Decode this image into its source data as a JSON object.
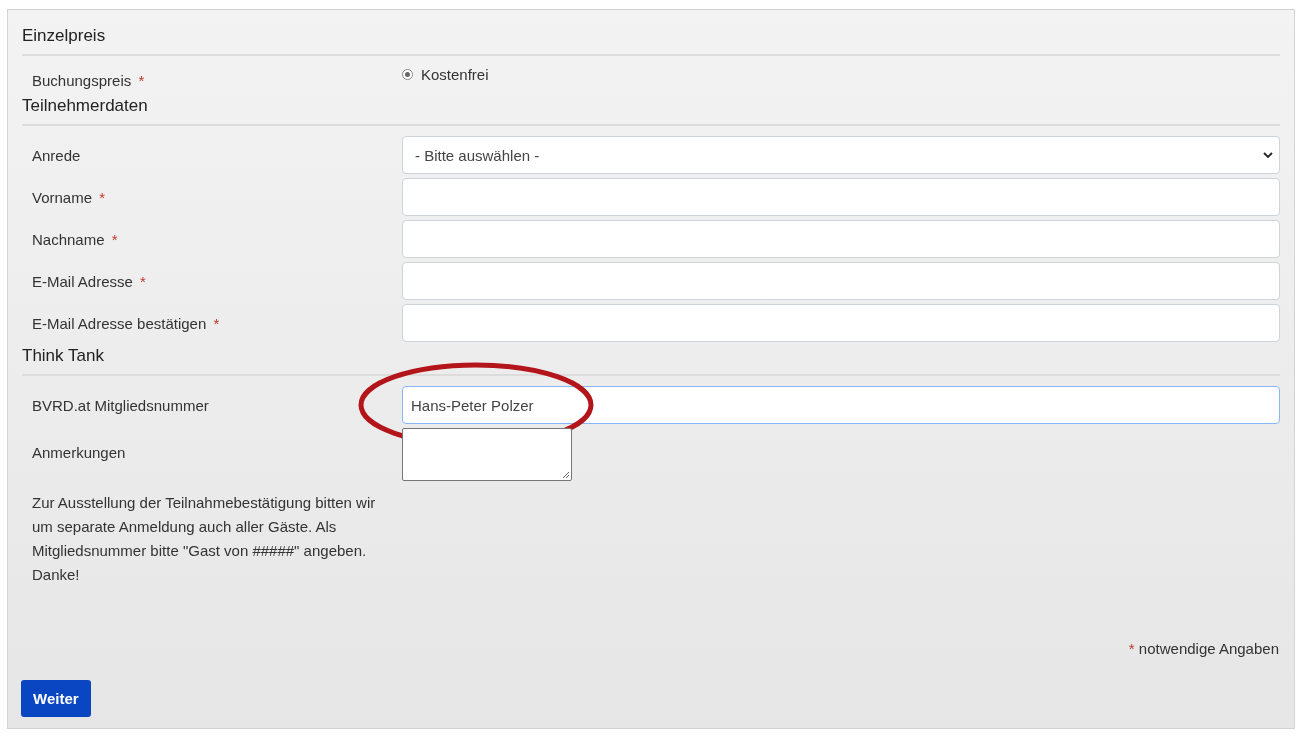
{
  "sections": [
    {
      "title": "Einzelpreis",
      "fields": [
        {
          "kind": "radio",
          "label": "Buchungspreis",
          "required_mark": "*",
          "option": "Kostenfrei",
          "checked": true
        }
      ]
    },
    {
      "title": "Teilnehmerdaten",
      "fields": [
        {
          "kind": "select",
          "label": "Anrede",
          "value": "- Bitte auswählen -"
        },
        {
          "kind": "text",
          "label": "Vorname",
          "required_mark": "*"
        },
        {
          "kind": "text",
          "label": "Nachname",
          "required_mark": "*"
        },
        {
          "kind": "text",
          "label": "E-Mail Adresse",
          "required_mark": "*"
        },
        {
          "kind": "text",
          "label": "E-Mail Adresse bestätigen",
          "required_mark": "*"
        }
      ]
    },
    {
      "title": "Think Tank",
      "fields": [
        {
          "kind": "text",
          "label": "BVRD.at Mitgliedsnummer",
          "value": "Hans-Peter Polzer",
          "focused": true,
          "circled": true
        },
        {
          "kind": "textarea",
          "label": "Anmerkungen"
        }
      ]
    }
  ],
  "note": "Zur Ausstellung der Teilnahmebestätigung bitten wir um separate Anmeldung auch aller Gäste. Als Mitgliedsnummer bitte \"Gast von #####\" angeben. Danke!",
  "legend": {
    "mark": "*",
    "text": "notwendige Angaben"
  },
  "button": "Weiter"
}
